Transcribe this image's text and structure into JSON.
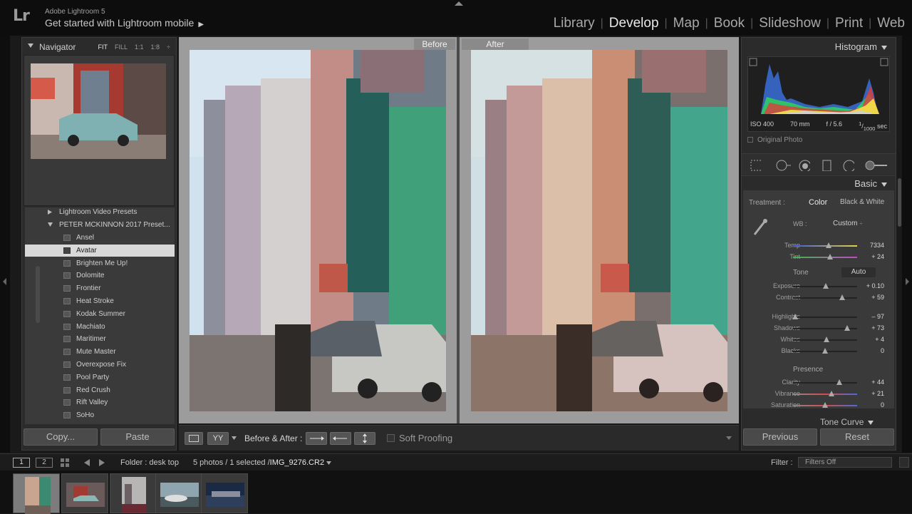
{
  "app": {
    "logo": "Lr",
    "name": "Adobe Lightroom 5",
    "mobile_link": "Get started with Lightroom mobile",
    "mobile_arrow": "▶"
  },
  "modules": {
    "items": [
      "Library",
      "Develop",
      "Map",
      "Book",
      "Slideshow",
      "Print",
      "Web"
    ],
    "active": "Develop",
    "separator": "|"
  },
  "navigator": {
    "title": "Navigator",
    "zoom_options": [
      "FIT",
      "FILL",
      "1:1",
      "1:8"
    ],
    "active_zoom": "FIT",
    "more": "÷"
  },
  "presets": {
    "groups": [
      {
        "label": "Lightroom Video Presets",
        "expanded": false
      },
      {
        "label": "PETER MCKINNON 2017 Preset...",
        "expanded": true
      }
    ],
    "items": [
      "Ansel",
      "Avatar",
      "Brighten Me Up!",
      "Dolomite",
      "Frontier",
      "Heat Stroke",
      "Kodak Summer",
      "Machiato",
      "Maritimer",
      "Mute Master",
      "Overexpose Fix",
      "Pool Party",
      "Red Crush",
      "Rift Valley",
      "SoHo"
    ],
    "selected": "Avatar"
  },
  "left_buttons": {
    "copy": "Copy...",
    "paste": "Paste"
  },
  "compare": {
    "before": "Before",
    "after": "After"
  },
  "toolbar": {
    "view_box": "YY",
    "before_after_label": "Before & After :",
    "soft_proofing": "Soft Proofing"
  },
  "histogram": {
    "title": "Histogram",
    "iso": "ISO 400",
    "focal": "70 mm",
    "aperture": "f / 5.6",
    "shutter_num": "1",
    "shutter_den": "1000",
    "shutter_unit": "sec",
    "original_photo": "Original Photo"
  },
  "basic": {
    "title": "Basic",
    "treatment_label": "Treatment :",
    "treatment_color": "Color",
    "treatment_bw": "Black & White",
    "wb_label": "WB :",
    "wb_value": "Custom",
    "wb_arrow": "÷",
    "tone_label": "Tone",
    "auto_label": "Auto",
    "presence_label": "Presence",
    "sliders": [
      {
        "label": "Temp",
        "value": "7334",
        "pos": 0.55
      },
      {
        "label": "Tint",
        "value": "+ 24",
        "pos": 0.58
      },
      {
        "label": "Exposure",
        "value": "+ 0.10",
        "pos": 0.51
      },
      {
        "label": "Contrast",
        "value": "+ 59",
        "pos": 0.77
      },
      {
        "label": "Highlights",
        "value": "– 97",
        "pos": 0.03
      },
      {
        "label": "Shadows",
        "value": "+ 73",
        "pos": 0.84
      },
      {
        "label": "Whites",
        "value": "+ 4",
        "pos": 0.52
      },
      {
        "label": "Blacks",
        "value": "0",
        "pos": 0.5
      },
      {
        "label": "Clarity",
        "value": "+ 44",
        "pos": 0.72
      },
      {
        "label": "Vibrance",
        "value": "+ 21",
        "pos": 0.6
      },
      {
        "label": "Saturation",
        "value": "0",
        "pos": 0.5
      }
    ],
    "next_panel": "Tone Curve"
  },
  "right_buttons": {
    "previous": "Previous",
    "reset": "Reset"
  },
  "filmstrip_bar": {
    "view_1": "1",
    "view_2": "2",
    "folder": "Folder : desk top",
    "count_prefix": "5 photos / 1 selected /",
    "filename": "IMG_9276.CR2",
    "filter_label": "Filter :",
    "filter_value": "Filters Off"
  },
  "colors": {
    "panel_bg": "#2b2b2b",
    "selected_preset": "#d8d8d8",
    "canvas_bg": "#9c9c9c"
  }
}
